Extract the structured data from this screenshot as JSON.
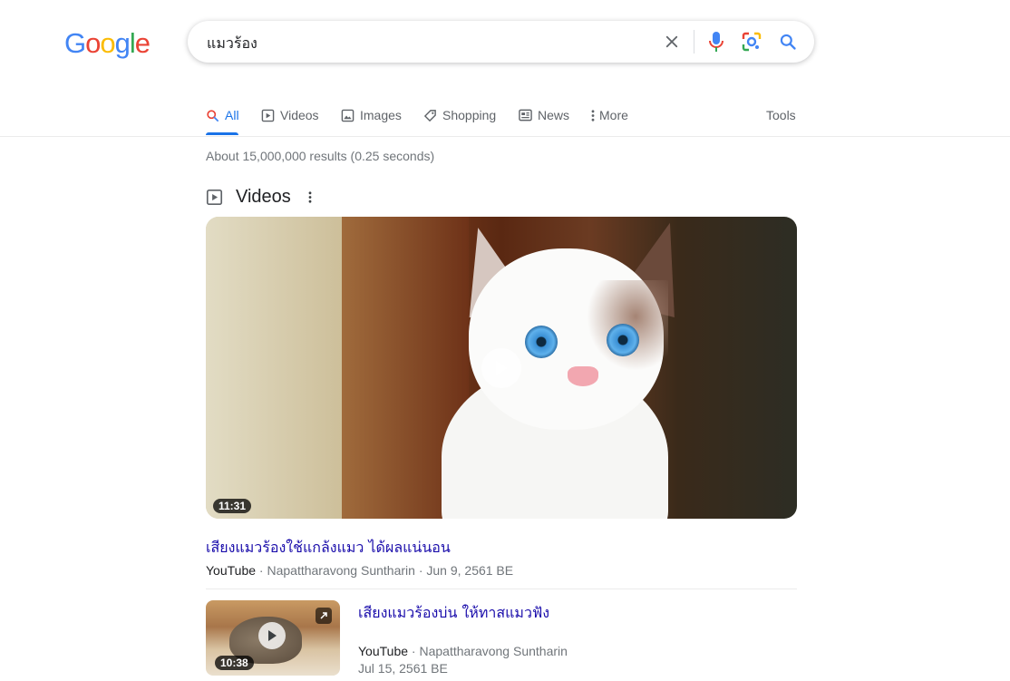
{
  "logo": {
    "text": "Google"
  },
  "search": {
    "query": "แมวร้อง"
  },
  "tabs": [
    {
      "label": "All"
    },
    {
      "label": "Videos"
    },
    {
      "label": "Images"
    },
    {
      "label": "Shopping"
    },
    {
      "label": "News"
    },
    {
      "label": "More"
    }
  ],
  "tools_label": "Tools",
  "stats": "About 15,000,000 results (0.25 seconds)",
  "videos_section": {
    "heading": "Videos",
    "items": [
      {
        "title": "เสียงแมวร้องใช้แกล้งแมว ได้ผลแน่นอน",
        "source": "YouTube",
        "channel": "Napattharavong Suntharin",
        "date": "Jun 9, 2561 BE",
        "duration": "11:31"
      },
      {
        "title": "เสียงแมวร้องบ่น ให้ทาสแมวฟัง",
        "source": "YouTube",
        "channel": "Napattharavong Suntharin",
        "date": "Jul 15, 2561 BE",
        "duration": "10:38"
      }
    ]
  },
  "colors": {
    "link": "#1a0dab",
    "accent": "#1a73e8",
    "muted": "#70757a"
  },
  "icons": [
    "clear-icon",
    "mic-icon",
    "lens-icon",
    "search-icon",
    "play-icon",
    "expand-icon",
    "more-vert-icon"
  ]
}
